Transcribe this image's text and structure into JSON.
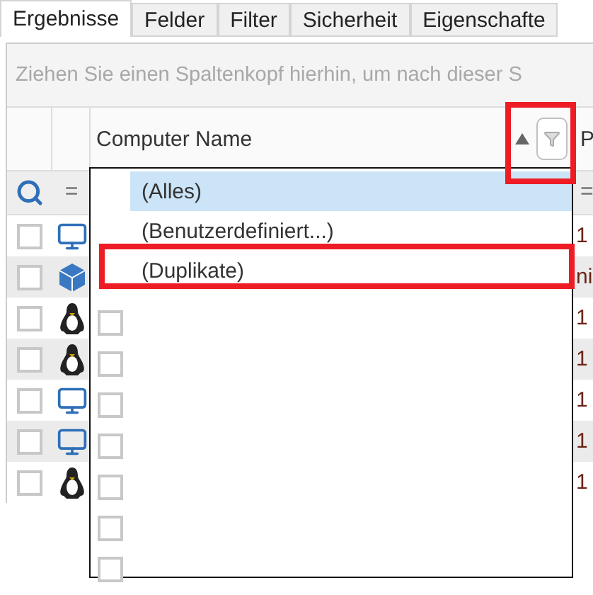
{
  "tabs": [
    {
      "label": "Ergebnisse",
      "selected": true
    },
    {
      "label": "Felder",
      "selected": false
    },
    {
      "label": "Filter",
      "selected": false
    },
    {
      "label": "Sicherheit",
      "selected": false
    },
    {
      "label": "Eigenschafte",
      "selected": false
    }
  ],
  "group_panel": {
    "placeholder": "Ziehen Sie einen Spaltenkopf hierhin, um nach dieser S"
  },
  "columns": [
    {
      "label": "Computer Name",
      "sort_ascending": true,
      "filter_open": true
    },
    {
      "label": "P"
    }
  ],
  "filter_row": {
    "operator": "=",
    "column_4_operator": "="
  },
  "rows": [
    {
      "kind": "desktop",
      "checked": false,
      "column_4": "1"
    },
    {
      "kind": "cube",
      "checked": false,
      "column_4": "ni"
    },
    {
      "kind": "penguin",
      "checked": false,
      "column_4": "1"
    },
    {
      "kind": "penguin",
      "checked": false,
      "column_4": "1"
    },
    {
      "kind": "desktop",
      "checked": false,
      "column_4": "1"
    },
    {
      "kind": "desktop",
      "checked": false,
      "column_4": "1"
    },
    {
      "kind": "penguin",
      "checked": false,
      "column_4": "1"
    }
  ],
  "filter_popup": {
    "options": [
      {
        "label": "(Alles)",
        "selected": true
      },
      {
        "label": "(Benutzerdefiniert...)",
        "selected": false
      },
      {
        "label": "(Duplikate)",
        "selected": false
      }
    ],
    "values": [
      {
        "checked": false
      },
      {
        "checked": false
      },
      {
        "checked": false
      },
      {
        "checked": false
      },
      {
        "checked": false
      },
      {
        "checked": false
      },
      {
        "checked": false
      }
    ]
  }
}
